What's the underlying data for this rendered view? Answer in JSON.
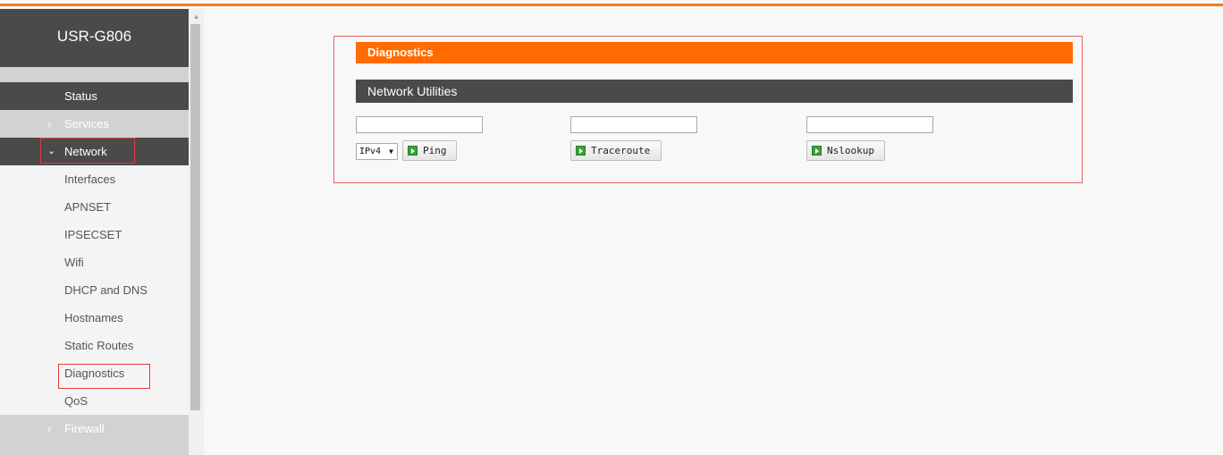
{
  "brand": "USR-G806",
  "menu": {
    "status": "Status",
    "services": "Services",
    "network": "Network",
    "interfaces": "Interfaces",
    "apnset": "APNSET",
    "ipsecset": "IPSECSET",
    "wifi": "Wifi",
    "dhcp": "DHCP and DNS",
    "hostnames": "Hostnames",
    "static_routes": "Static Routes",
    "diagnostics": "Diagnostics",
    "qos": "QoS",
    "firewall": "Firewall"
  },
  "panel": {
    "title": "Diagnostics",
    "section": "Network Utilities",
    "ip_version": "IPv4",
    "ping_label": "Ping",
    "traceroute_label": "Traceroute",
    "nslookup_label": "Nslookup"
  },
  "colors": {
    "accent": "#ff6b00",
    "dark": "#4a4a4a",
    "highlight": "#e03c3c"
  }
}
